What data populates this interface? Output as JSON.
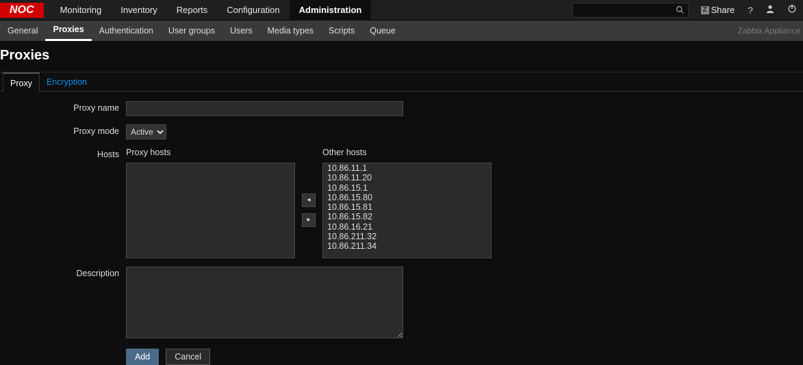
{
  "logo": "NOC",
  "topnav": {
    "items": [
      {
        "label": "Monitoring"
      },
      {
        "label": "Inventory"
      },
      {
        "label": "Reports"
      },
      {
        "label": "Configuration"
      },
      {
        "label": "Administration"
      }
    ],
    "active": 4,
    "share_label": "Share",
    "share_z": "Z"
  },
  "subnav": {
    "items": [
      {
        "label": "General"
      },
      {
        "label": "Proxies"
      },
      {
        "label": "Authentication"
      },
      {
        "label": "User groups"
      },
      {
        "label": "Users"
      },
      {
        "label": "Media types"
      },
      {
        "label": "Scripts"
      },
      {
        "label": "Queue"
      }
    ],
    "active": 1,
    "appliance": "Zabbix Appliance"
  },
  "page_title": "Proxies",
  "tabs": {
    "items": [
      {
        "label": "Proxy"
      },
      {
        "label": "Encryption"
      }
    ],
    "active": 0
  },
  "form": {
    "proxy_name_label": "Proxy name",
    "proxy_name_value": "",
    "proxy_mode_label": "Proxy mode",
    "proxy_mode_value": "Active",
    "hosts_label": "Hosts",
    "proxy_hosts_header": "Proxy hosts",
    "other_hosts_header": "Other hosts",
    "proxy_hosts": [],
    "other_hosts": [
      "10.86.11.1",
      "10.86.11.20",
      "10.86.15.1",
      "10.86.15.80",
      "10.86.15.81",
      "10.86.15.82",
      "10.86.16.21",
      "10.86.211.32",
      "10.86.211.34"
    ],
    "description_label": "Description",
    "description_value": "",
    "add_label": "Add",
    "cancel_label": "Cancel"
  }
}
